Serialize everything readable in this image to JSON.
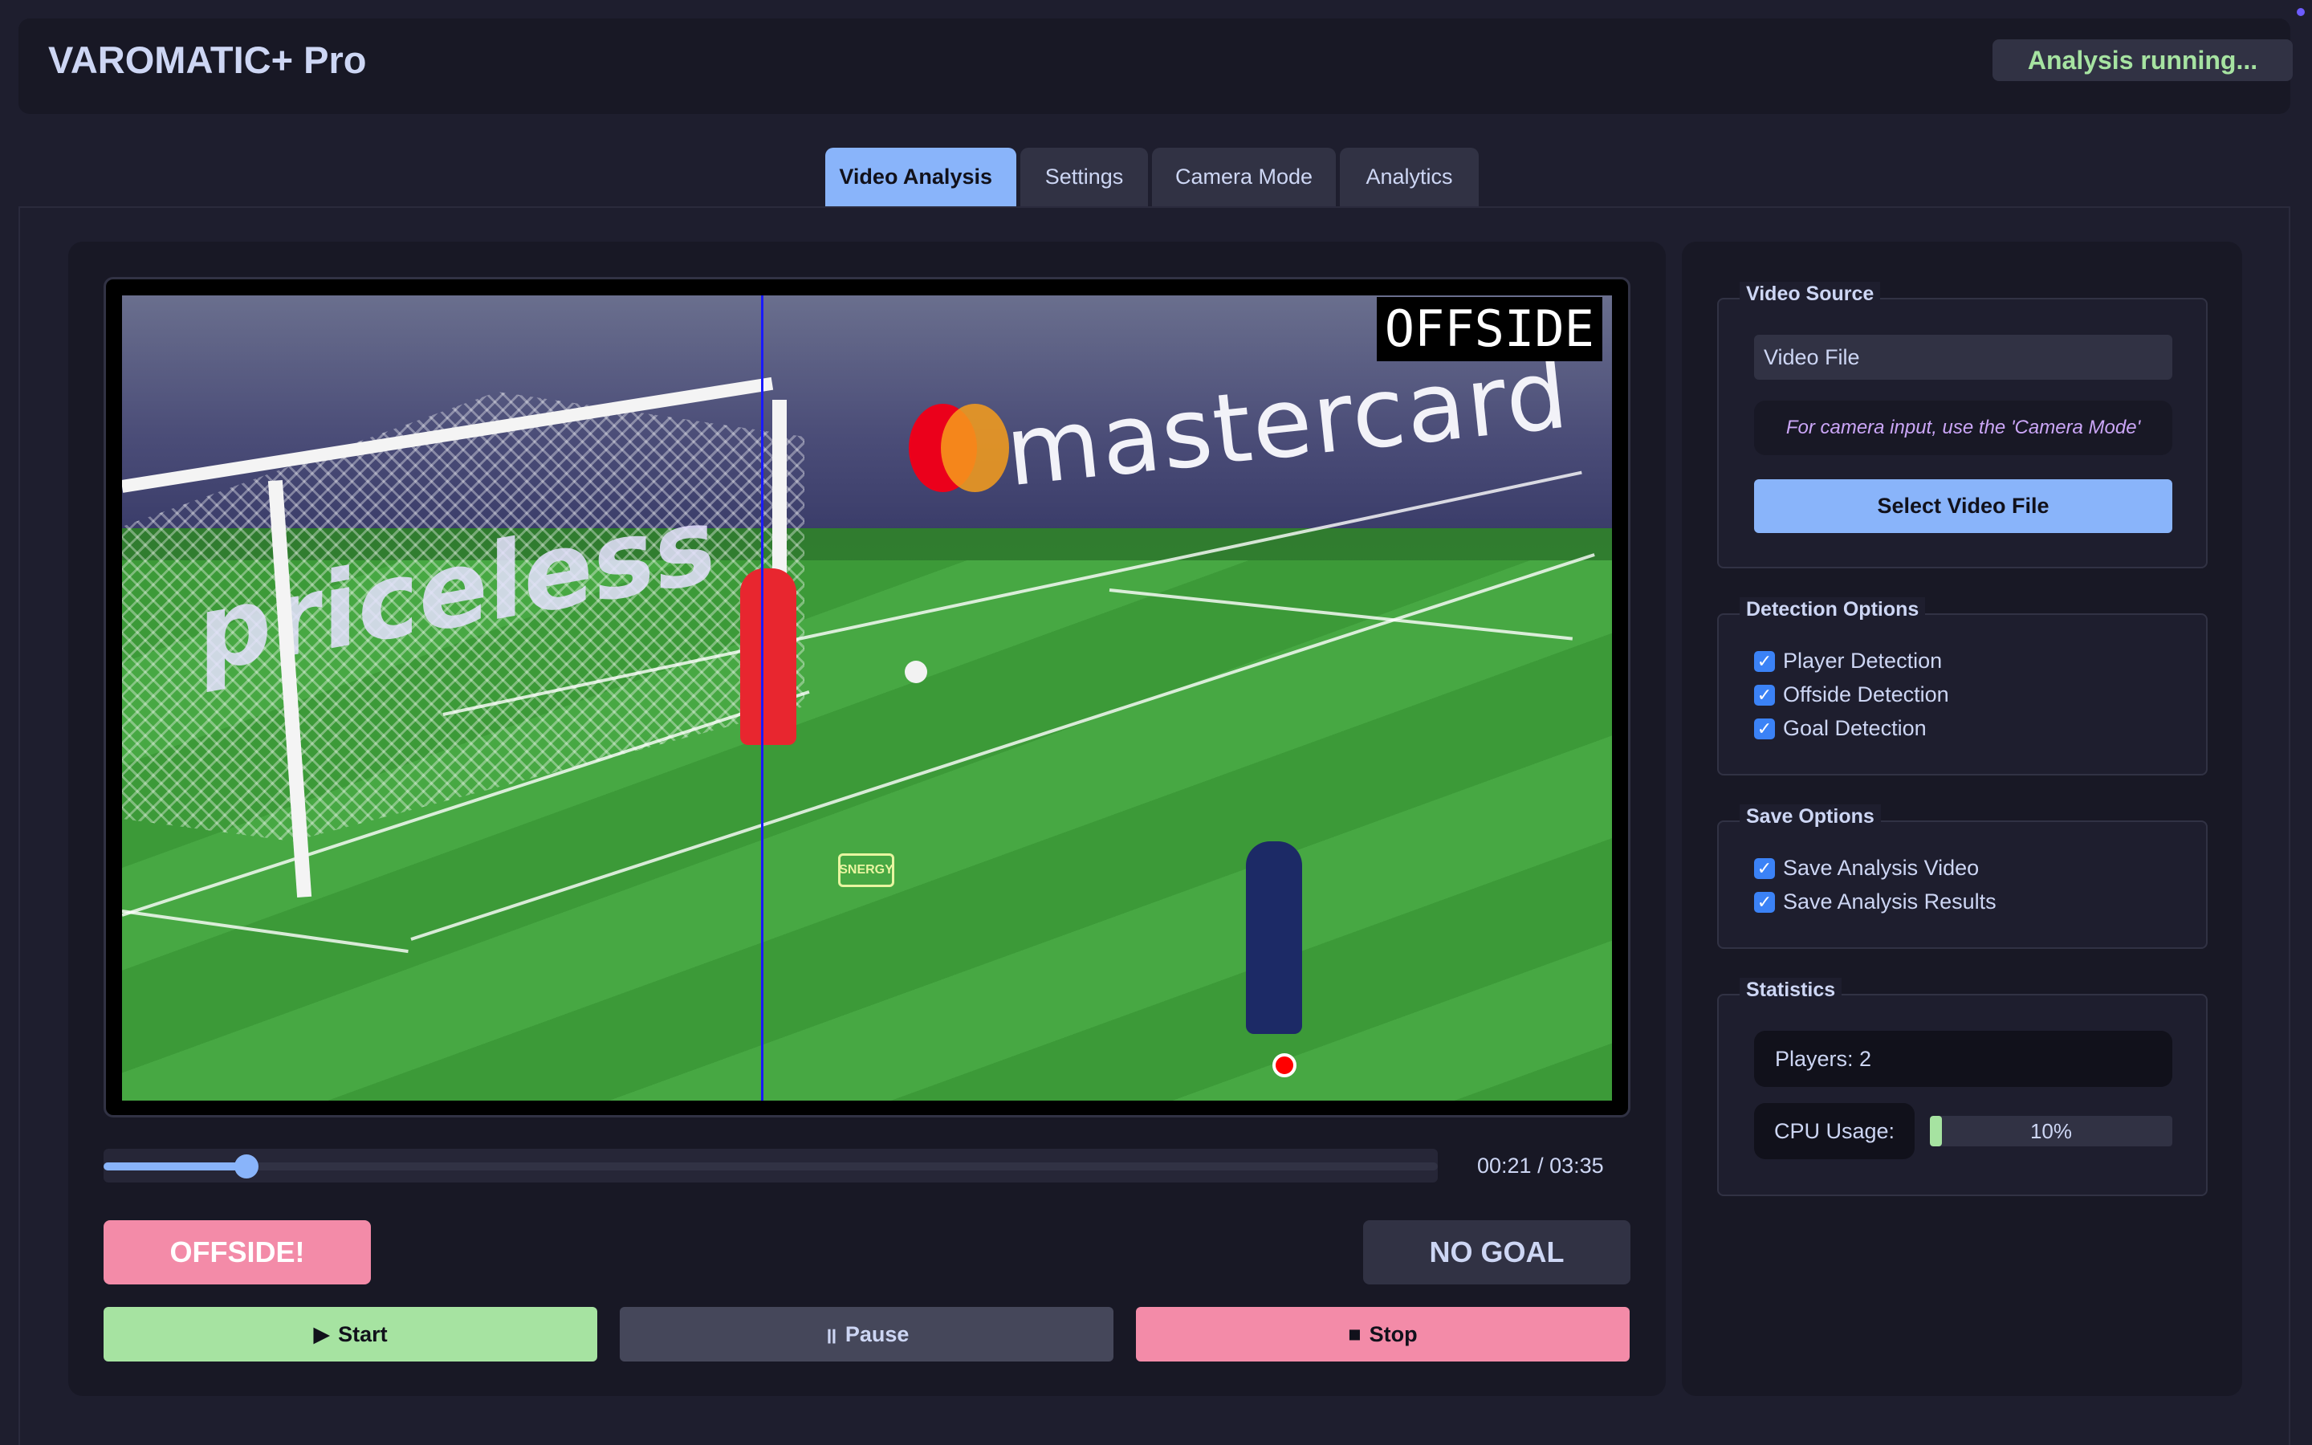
{
  "app": {
    "title": "VAROMATIC+ Pro",
    "status": "Analysis running..."
  },
  "tabs": [
    {
      "label": "Video Analysis",
      "active": true
    },
    {
      "label": "Settings",
      "active": false
    },
    {
      "label": "Camera Mode",
      "active": false
    },
    {
      "label": "Analytics",
      "active": false
    }
  ],
  "video": {
    "overlay_label": "OFFSIDE",
    "board_text": "mastercard",
    "pitch_text": "priceless",
    "sponsor_tag": "SNERGY",
    "current_time": "00:21",
    "total_time": "03:35",
    "time_display": "00:21 / 03:35",
    "progress_fraction": 0.107
  },
  "decisions": {
    "offside": "OFFSIDE!",
    "goal": "NO GOAL"
  },
  "controls": {
    "start_icon": "▶",
    "start": "Start",
    "pause_icon": "॥",
    "pause": "Pause",
    "stop_icon": "■",
    "stop": "Stop"
  },
  "sidebar": {
    "video_source": {
      "title": "Video Source",
      "field_value": "Video File",
      "hint": "For camera input, use the 'Camera Mode'",
      "select_button": "Select Video File"
    },
    "detection": {
      "title": "Detection Options",
      "items": [
        {
          "label": "Player Detection",
          "checked": true
        },
        {
          "label": "Offside Detection",
          "checked": true
        },
        {
          "label": "Goal Detection",
          "checked": true
        }
      ]
    },
    "save": {
      "title": "Save Options",
      "items": [
        {
          "label": "Save Analysis Video",
          "checked": true
        },
        {
          "label": "Save Analysis Results",
          "checked": true
        }
      ]
    },
    "statistics": {
      "title": "Statistics",
      "players": "Players: 2",
      "cpu_label": "CPU Usage:",
      "cpu_percent_text": "10%",
      "cpu_fraction": 0.1
    }
  },
  "colors": {
    "accent": "#89b4fa",
    "success": "#a6e3a1",
    "danger": "#f38ba8",
    "offside_line": "#1a1aff"
  }
}
